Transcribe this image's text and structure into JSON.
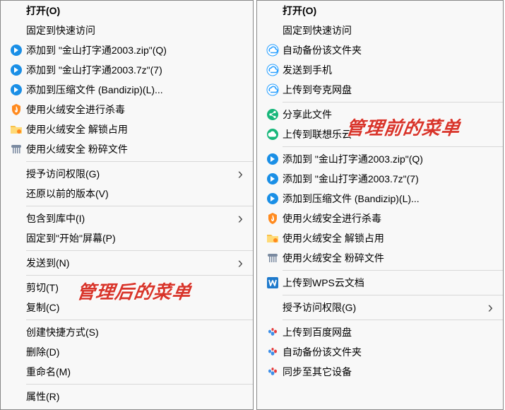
{
  "overlays": {
    "left": "管理后的菜单",
    "right": "管理前的菜单"
  },
  "left": {
    "items": [
      {
        "icon": "",
        "label": "打开(O)",
        "bold": true
      },
      {
        "icon": "",
        "label": "固定到快速访问"
      },
      {
        "icon": "bz-blue",
        "label": "添加到 \"金山打字通2003.zip\"(Q)"
      },
      {
        "icon": "bz-blue",
        "label": "添加到 \"金山打字通2003.7z\"(7)"
      },
      {
        "icon": "bz-blue",
        "label": "添加到压缩文件 (Bandizip)(L)..."
      },
      {
        "icon": "huorong-shield",
        "label": "使用火绒安全进行杀毒"
      },
      {
        "icon": "huorong-folder",
        "label": "使用火绒安全 解锁占用"
      },
      {
        "icon": "huorong-shred",
        "label": "使用火绒安全 粉碎文件"
      },
      {
        "sep": true
      },
      {
        "icon": "",
        "label": "授予访问权限(G)",
        "sub": true
      },
      {
        "icon": "",
        "label": "还原以前的版本(V)"
      },
      {
        "sep": true
      },
      {
        "icon": "",
        "label": "包含到库中(I)",
        "sub": true
      },
      {
        "icon": "",
        "label": "固定到\"开始\"屏幕(P)"
      },
      {
        "sep": true
      },
      {
        "icon": "",
        "label": "发送到(N)",
        "sub": true
      },
      {
        "sep": true
      },
      {
        "icon": "",
        "label": "剪切(T)"
      },
      {
        "icon": "",
        "label": "复制(C)"
      },
      {
        "sep": true
      },
      {
        "icon": "",
        "label": "创建快捷方式(S)"
      },
      {
        "icon": "",
        "label": "删除(D)"
      },
      {
        "icon": "",
        "label": "重命名(M)"
      },
      {
        "sep": true
      },
      {
        "icon": "",
        "label": "属性(R)"
      }
    ]
  },
  "right": {
    "items": [
      {
        "icon": "",
        "label": "打开(O)",
        "bold": true
      },
      {
        "icon": "",
        "label": "固定到快速访问"
      },
      {
        "icon": "kuake",
        "label": "自动备份该文件夹"
      },
      {
        "icon": "kuake",
        "label": "发送到手机"
      },
      {
        "icon": "kuake",
        "label": "上传到夸克网盘"
      },
      {
        "sep": true
      },
      {
        "icon": "share-green",
        "label": "分享此文件"
      },
      {
        "icon": "lenovo-green",
        "label": "上传到联想乐云"
      },
      {
        "sep": true
      },
      {
        "icon": "bz-blue",
        "label": "添加到 \"金山打字通2003.zip\"(Q)"
      },
      {
        "icon": "bz-blue",
        "label": "添加到 \"金山打字通2003.7z\"(7)"
      },
      {
        "icon": "bz-blue",
        "label": "添加到压缩文件 (Bandizip)(L)..."
      },
      {
        "icon": "huorong-shield",
        "label": "使用火绒安全进行杀毒"
      },
      {
        "icon": "huorong-folder",
        "label": "使用火绒安全 解锁占用"
      },
      {
        "icon": "huorong-shred",
        "label": "使用火绒安全 粉碎文件"
      },
      {
        "sep": true
      },
      {
        "icon": "wps",
        "label": "上传到WPS云文档"
      },
      {
        "sep": true
      },
      {
        "icon": "",
        "label": "授予访问权限(G)",
        "sub": true
      },
      {
        "sep": true
      },
      {
        "icon": "baidu",
        "label": "上传到百度网盘"
      },
      {
        "icon": "baidu",
        "label": "自动备份该文件夹"
      },
      {
        "icon": "baidu",
        "label": "同步至其它设备"
      }
    ]
  }
}
